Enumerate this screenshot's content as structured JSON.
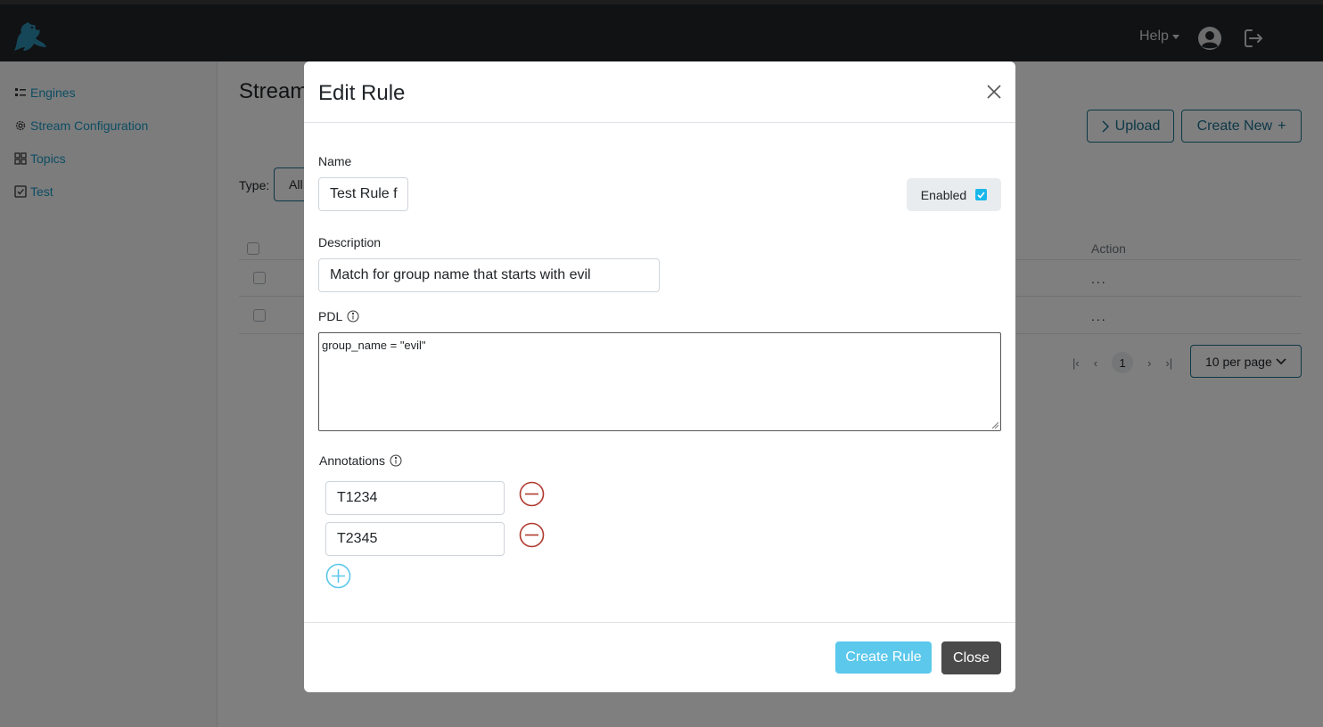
{
  "header": {
    "help_label": "Help"
  },
  "sidebar": {
    "items": [
      {
        "label": "Engines",
        "icon": "list-icon"
      },
      {
        "label": "Stream Configuration",
        "icon": "gear-icon"
      },
      {
        "label": "Topics",
        "icon": "grid-icon"
      },
      {
        "label": "Test",
        "icon": "checkbox-icon"
      }
    ]
  },
  "main": {
    "title": "Stream",
    "upload_label": "Upload",
    "create_new_label": "Create New",
    "type_label": "Type:",
    "type_value": "All",
    "action_header": "Action",
    "row_action": "...",
    "pagination": {
      "current_page": "1",
      "per_page": "10 per page"
    }
  },
  "modal": {
    "title": "Edit Rule",
    "name_label": "Name",
    "name_value": "Test Rule f",
    "enabled_label": "Enabled",
    "enabled_checked": true,
    "description_label": "Description",
    "description_value": "Match for group name that starts with evil",
    "pdl_label": "PDL",
    "pdl_value": "group_name = \"evil\"",
    "annotations_label": "Annotations",
    "annotations": [
      "T1234",
      "T2345"
    ],
    "create_button": "Create Rule",
    "close_button": "Close"
  },
  "colors": {
    "accent": "#1a9bc4",
    "create_button": "#5bc8ec",
    "remove_icon": "#b03a2e",
    "add_icon": "#5bc8ec"
  }
}
